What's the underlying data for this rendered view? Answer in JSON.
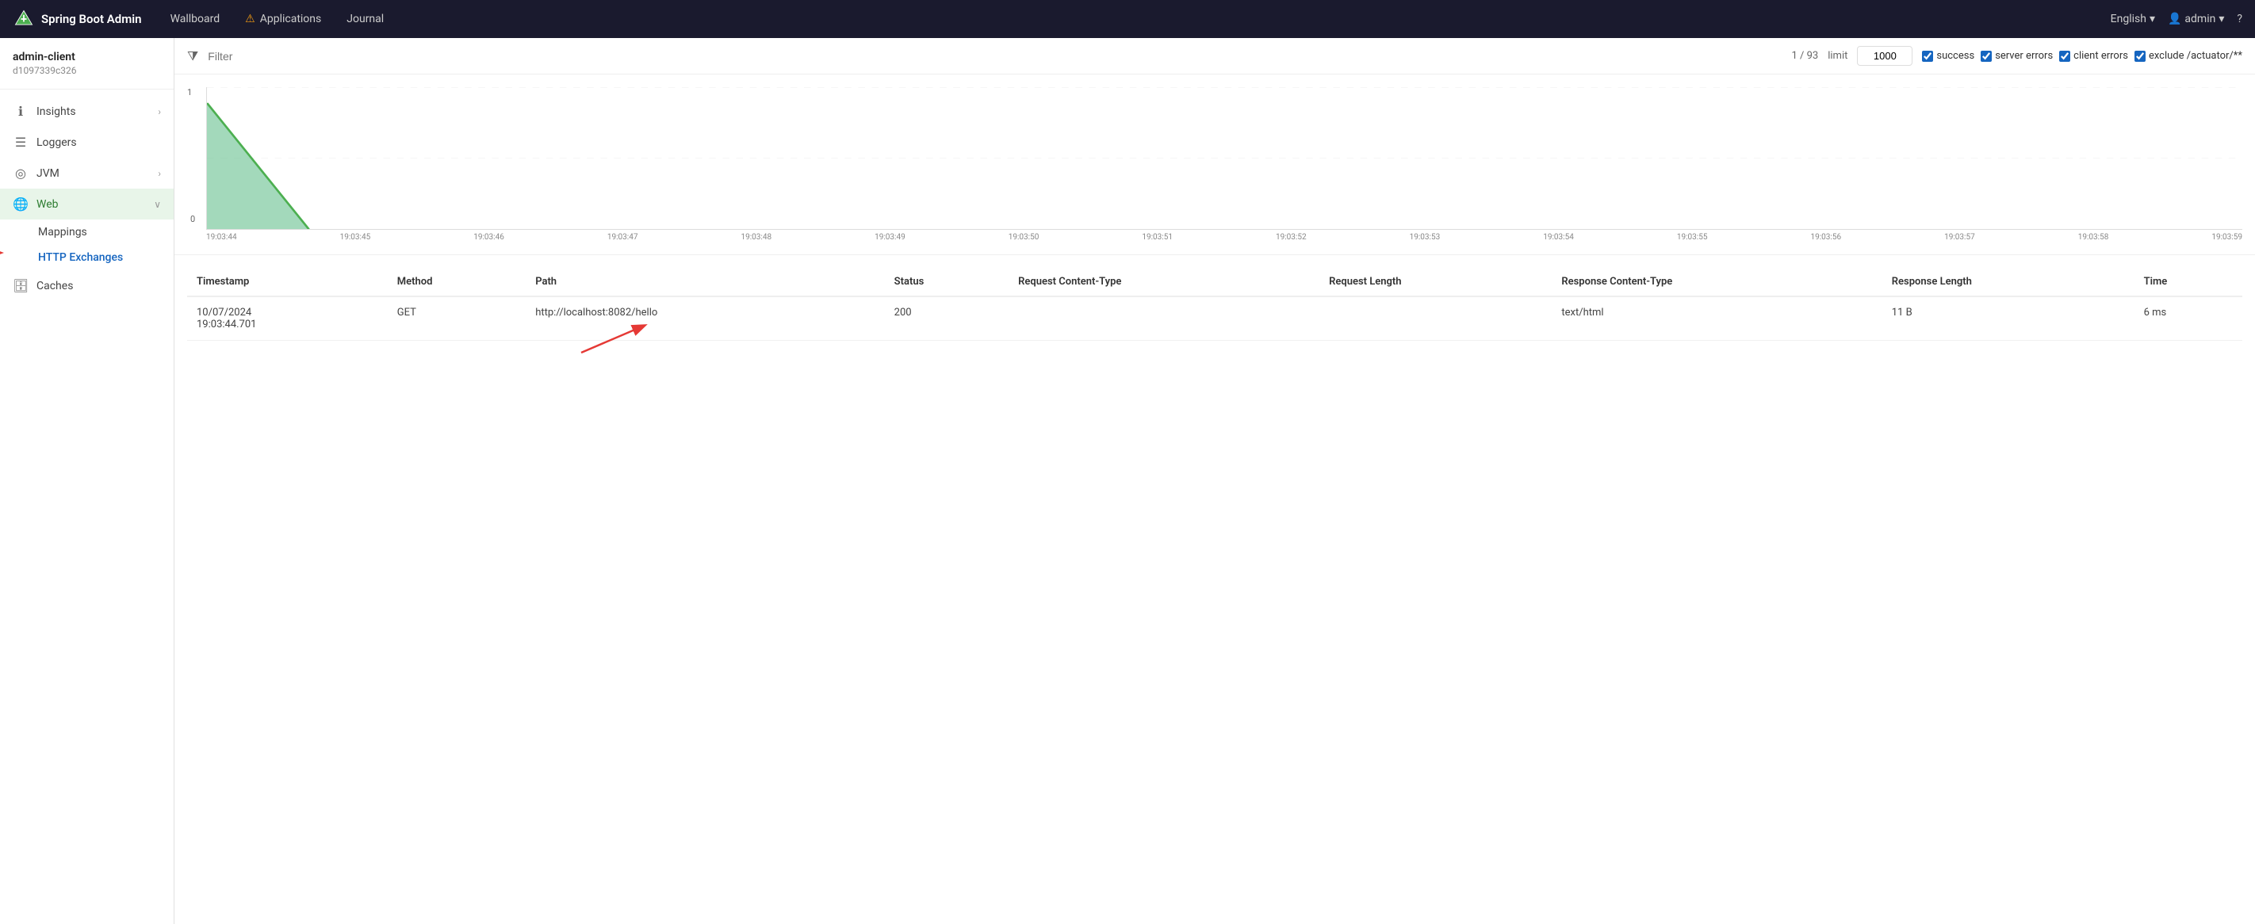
{
  "topnav": {
    "brand": "Spring Boot Admin",
    "links": [
      {
        "label": "Wallboard",
        "id": "wallboard"
      },
      {
        "label": "Applications",
        "id": "applications",
        "warn": true
      },
      {
        "label": "Journal",
        "id": "journal"
      }
    ],
    "language": "English",
    "user": "admin",
    "help": "?"
  },
  "sidebar": {
    "client_name": "admin-client",
    "client_id": "d1097339c326",
    "items": [
      {
        "id": "insights",
        "label": "Insights",
        "icon": "ℹ",
        "has_arrow": true
      },
      {
        "id": "loggers",
        "label": "Loggers",
        "icon": "📋",
        "has_arrow": false
      },
      {
        "id": "jvm",
        "label": "JVM",
        "icon": "⊙",
        "has_arrow": true
      },
      {
        "id": "web",
        "label": "Web",
        "icon": "🌐",
        "has_arrow": true,
        "expanded": true
      }
    ],
    "sub_items": [
      {
        "id": "mappings",
        "label": "Mappings"
      },
      {
        "id": "http-exchanges",
        "label": "HTTP Exchanges",
        "active": true
      }
    ],
    "extra_items": [
      {
        "id": "caches",
        "label": "Caches",
        "icon": "🗄"
      }
    ]
  },
  "filter": {
    "placeholder": "Filter",
    "count": "1 / 93",
    "limit_label": "limit",
    "limit_value": "1000",
    "checkboxes": [
      {
        "id": "success",
        "label": "success",
        "checked": true
      },
      {
        "id": "server-errors",
        "label": "server errors",
        "checked": true
      },
      {
        "id": "client-errors",
        "label": "client errors",
        "checked": true
      },
      {
        "id": "exclude-actuator",
        "label": "exclude /actuator/**",
        "checked": true
      }
    ]
  },
  "chart": {
    "y_max": "1",
    "y_min": "0",
    "x_labels": [
      "19:03:44",
      "19:03:45",
      "19:03:46",
      "19:03:47",
      "19:03:48",
      "19:03:49",
      "19:03:50",
      "19:03:51",
      "19:03:52",
      "19:03:53",
      "19:03:54",
      "19:03:55",
      "19:03:56",
      "19:03:57",
      "19:03:58",
      "19:03:59"
    ]
  },
  "table": {
    "headers": [
      "Timestamp",
      "Method",
      "Path",
      "Status",
      "Request Content-Type",
      "Request Length",
      "Response Content-Type",
      "Response Length",
      "Time"
    ],
    "rows": [
      {
        "timestamp": "10/07/2024\n19:03:44.701",
        "method": "GET",
        "path": "http://localhost:8082/hello",
        "status": "200",
        "request_content_type": "",
        "request_length": "",
        "response_content_type": "text/html",
        "response_length": "11 B",
        "time": "6 ms"
      }
    ]
  }
}
